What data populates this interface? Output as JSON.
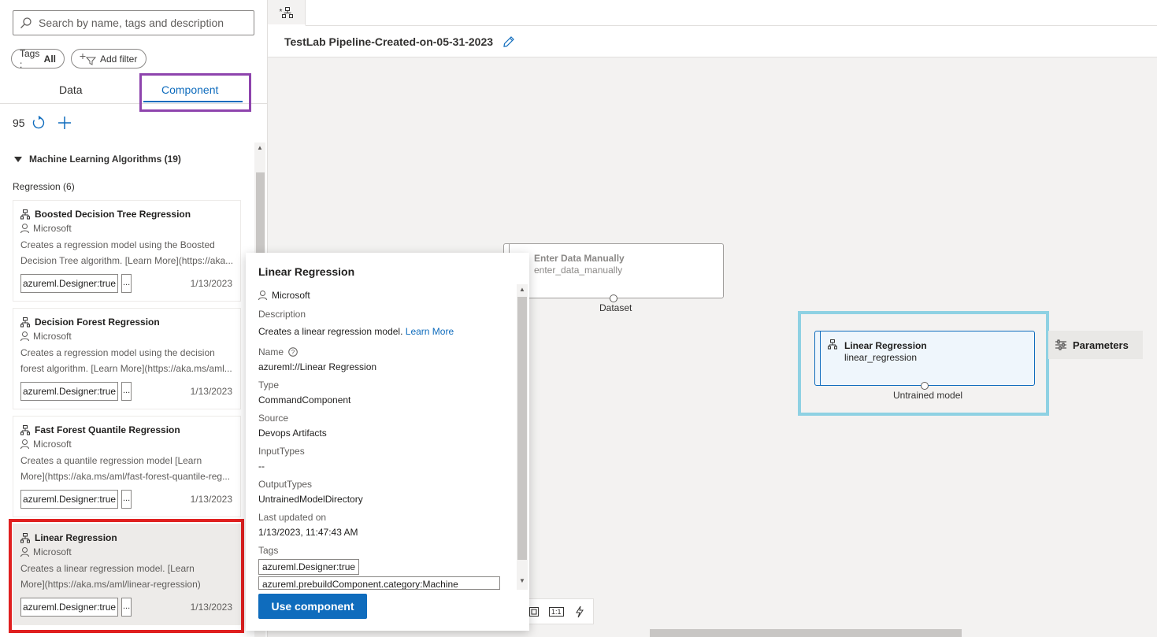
{
  "search": {
    "placeholder": "Search by name, tags and description"
  },
  "filters": {
    "tags_label": "Tags : ",
    "tags_value": "All",
    "add_filter": "Add filter"
  },
  "tabs": {
    "data": "Data",
    "component": "Component"
  },
  "list": {
    "count": "95",
    "group": "Machine Learning Algorithms (19)",
    "subgroup": "Regression (6)",
    "cards": [
      {
        "title": "Boosted Decision Tree Regression",
        "author": "Microsoft",
        "desc1": "Creates a regression model using the Boosted",
        "desc2": "Decision Tree algorithm. [Learn More](https://aka....",
        "tag": "azureml.Designer:true",
        "more": "...",
        "date": "1/13/2023"
      },
      {
        "title": "Decision Forest Regression",
        "author": "Microsoft",
        "desc1": "Creates a regression model using the decision",
        "desc2": "forest algorithm. [Learn More](https://aka.ms/aml...",
        "tag": "azureml.Designer:true",
        "more": "...",
        "date": "1/13/2023"
      },
      {
        "title": "Fast Forest Quantile Regression",
        "author": "Microsoft",
        "desc1": "Creates a quantile regression model [Learn",
        "desc2": "More](https://aka.ms/aml/fast-forest-quantile-reg...",
        "tag": "azureml.Designer:true",
        "more": "...",
        "date": "1/13/2023"
      },
      {
        "title": "Linear Regression",
        "author": "Microsoft",
        "desc1": "Creates a linear regression model. [Learn",
        "desc2": "More](https://aka.ms/aml/linear-regression)",
        "tag": "azureml.Designer:true",
        "more": "...",
        "date": "1/13/2023"
      }
    ]
  },
  "doc_tab": {
    "label": "*"
  },
  "pipeline": {
    "title": "TestLab Pipeline-Created-on-05-31-2023"
  },
  "nodes": {
    "enter": {
      "title": "Enter Data Manually",
      "sub": "enter_data_manually",
      "port": "Dataset"
    },
    "linear": {
      "title": "Linear Regression",
      "sub": "linear_regression",
      "port": "Untrained model"
    }
  },
  "parameters_label": "Parameters",
  "popup": {
    "title": "Linear Regression",
    "author": "Microsoft",
    "description_label": "Description",
    "description": "Creates a linear regression model.",
    "learn_more": "Learn More",
    "name_label": "Name",
    "name": "azureml://Linear Regression",
    "type_label": "Type",
    "type": "CommandComponent",
    "source_label": "Source",
    "source": "Devops Artifacts",
    "input_label": "InputTypes",
    "input": "--",
    "output_label": "OutputTypes",
    "output": "UntrainedModelDirectory",
    "updated_label": "Last updated on",
    "updated": "1/13/2023, 11:47:43 AM",
    "tags_label": "Tags",
    "tag1": "azureml.Designer:true",
    "tag2": "azureml.prebuildComponent.category:Machine",
    "use_button": "Use component"
  },
  "toolbar": {
    "fit_label": "1:1"
  },
  "colors": {
    "accent": "#0f6cbd",
    "highlight_purple": "#8e44ad",
    "highlight_red": "#e02020",
    "highlight_blue": "#8ed1e3"
  }
}
